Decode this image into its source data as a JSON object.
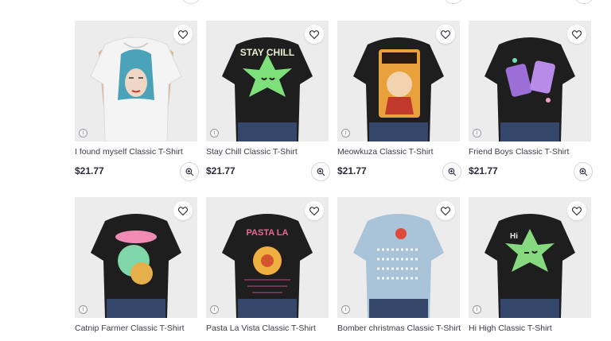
{
  "products": [
    {
      "title": "I found myself Classic T-Shirt",
      "price": "$21.77",
      "shirt_color": "#f2f2f2",
      "graphic": "face"
    },
    {
      "title": "Stay Chill Classic T-Shirt",
      "price": "$21.77",
      "shirt_color": "#1e1e1e",
      "graphic": "leaf-smile"
    },
    {
      "title": "Meowkuza Classic T-Shirt",
      "price": "$21.77",
      "shirt_color": "#1e1e1e",
      "graphic": "cat-poster"
    },
    {
      "title": "Friend Boys Classic T-Shirt",
      "price": "$21.77",
      "shirt_color": "#1e1e1e",
      "graphic": "game-boys"
    },
    {
      "title": "Catnip Farmer Classic T-Shirt",
      "price": "",
      "shirt_color": "#1e1e1e",
      "graphic": "catnip"
    },
    {
      "title": "Pasta La Vista Classic T-Shirt",
      "price": "",
      "shirt_color": "#1e1e1e",
      "graphic": "pasta"
    },
    {
      "title": "Bomber christmas Classic T-Shirt",
      "price": "",
      "shirt_color": "#a9c4d8",
      "graphic": "sweater"
    },
    {
      "title": "Hi High Classic T-Shirt",
      "price": "",
      "shirt_color": "#1e1e1e",
      "graphic": "leaf-wink"
    }
  ],
  "icons": {
    "favorite": "heart-icon",
    "zoom": "zoom-in-icon",
    "info": "info-icon"
  }
}
